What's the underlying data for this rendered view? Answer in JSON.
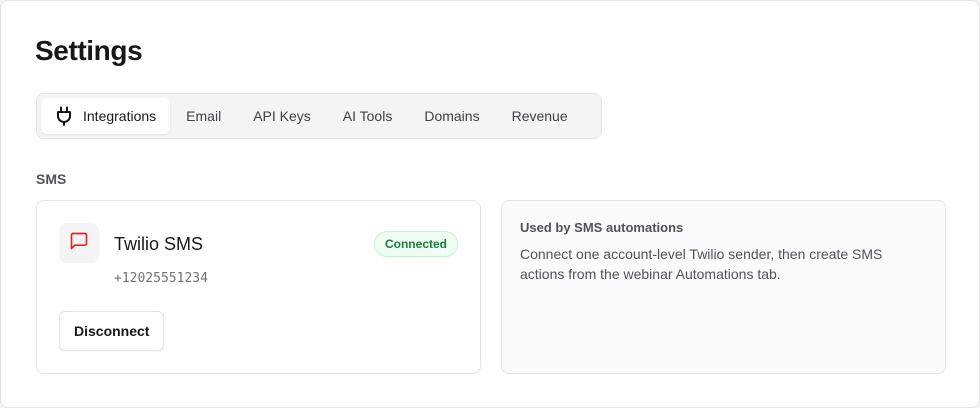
{
  "page": {
    "title": "Settings"
  },
  "tabs": [
    {
      "label": "Integrations",
      "icon": "plug-icon",
      "active": true
    },
    {
      "label": "Email",
      "active": false
    },
    {
      "label": "API Keys",
      "active": false
    },
    {
      "label": "AI Tools",
      "active": false
    },
    {
      "label": "Domains",
      "active": false
    },
    {
      "label": "Revenue",
      "active": false
    }
  ],
  "sms_section": {
    "label": "SMS",
    "integration": {
      "icon": "message-square-icon",
      "name": "Twilio SMS",
      "status": "Connected",
      "phone": "+12025551234",
      "disconnect_label": "Disconnect"
    },
    "info": {
      "title": "Used by SMS automations",
      "body": "Connect one account-level Twilio sender, then create SMS actions from the webinar Automations tab."
    }
  },
  "colors": {
    "status_green": "#15803d",
    "icon_red": "#dc2626",
    "border": "#e4e4e7"
  }
}
